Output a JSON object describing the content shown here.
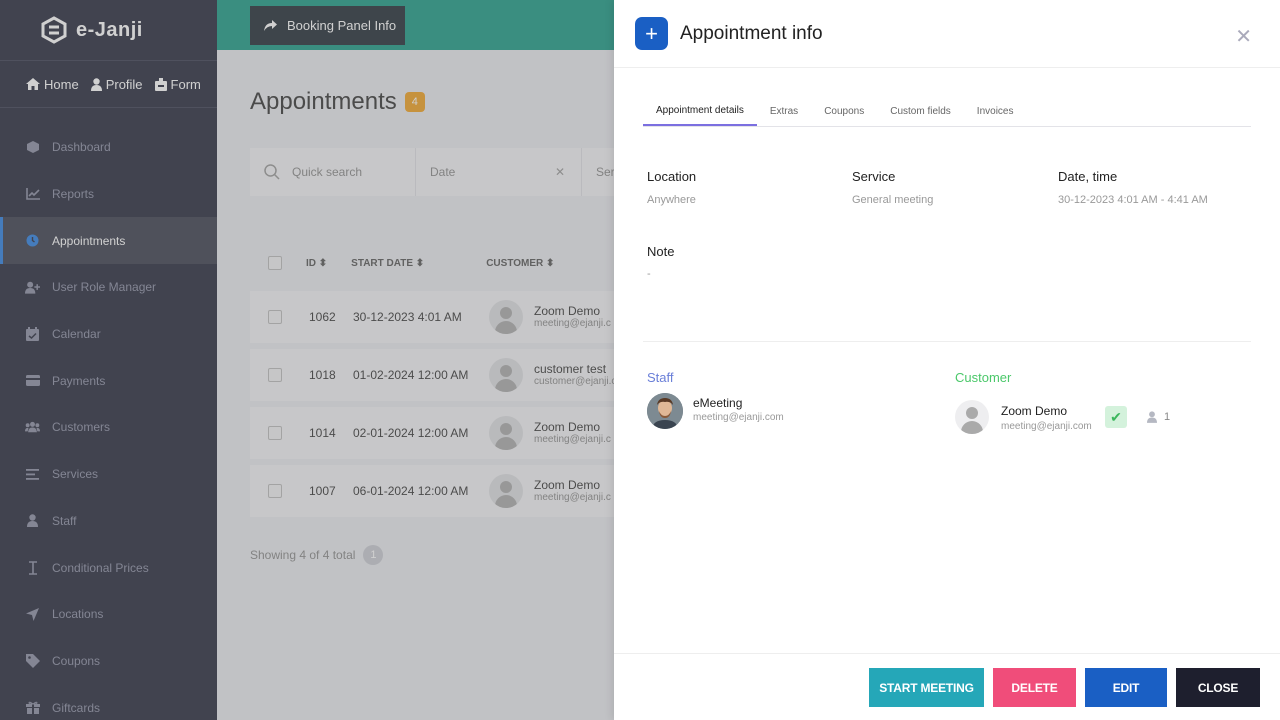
{
  "app": {
    "logo_text": "e-Janji"
  },
  "quicknav": [
    {
      "label": "Home"
    },
    {
      "label": "Profile"
    },
    {
      "label": "Form"
    }
  ],
  "sidebar": {
    "items": [
      {
        "label": "Dashboard",
        "icon": "cube-icon"
      },
      {
        "label": "Reports",
        "icon": "chart-icon"
      },
      {
        "label": "Appointments",
        "icon": "clock-icon",
        "active": true
      },
      {
        "label": "User Role Manager",
        "icon": "user-plus-icon"
      },
      {
        "label": "Calendar",
        "icon": "calendar-icon"
      },
      {
        "label": "Payments",
        "icon": "card-icon"
      },
      {
        "label": "Customers",
        "icon": "users-icon"
      },
      {
        "label": "Services",
        "icon": "list-icon"
      },
      {
        "label": "Staff",
        "icon": "user-icon"
      },
      {
        "label": "Conditional Prices",
        "icon": "text-cursor-icon"
      },
      {
        "label": "Locations",
        "icon": "location-arrow-icon"
      },
      {
        "label": "Coupons",
        "icon": "tag-icon"
      },
      {
        "label": "Giftcards",
        "icon": "gift-icon"
      }
    ]
  },
  "topbar": {
    "booking_panel_label": "Booking Panel Info"
  },
  "page": {
    "title": "Appointments",
    "count": "4"
  },
  "filters": {
    "search_placeholder": "Quick search",
    "date_placeholder": "Date",
    "service_placeholder": "Serv"
  },
  "table": {
    "columns": [
      "ID",
      "START DATE",
      "CUSTOMER"
    ],
    "rows": [
      {
        "id": "1062",
        "start": "30-12-2023 4:01 AM",
        "customer": "Zoom Demo",
        "email": "meeting@ejanji.c"
      },
      {
        "id": "1018",
        "start": "01-02-2024 12:00 AM",
        "customer": "customer test",
        "email": "customer@ejanji.c"
      },
      {
        "id": "1014",
        "start": "02-01-2024 12:00 AM",
        "customer": "Zoom Demo",
        "email": "meeting@ejanji.c"
      },
      {
        "id": "1007",
        "start": "06-01-2024 12:00 AM",
        "customer": "Zoom Demo",
        "email": "meeting@ejanji.c"
      }
    ],
    "showing": "Showing 4 of 4 total",
    "page": "1"
  },
  "panel": {
    "title": "Appointment info",
    "close_glyph": "✕",
    "tabs": [
      "Appointment details",
      "Extras",
      "Coupons",
      "Custom fields",
      "Invoices"
    ],
    "location_label": "Location",
    "location_value": "Anywhere",
    "service_label": "Service",
    "service_value": "General meeting",
    "datetime_label": "Date, time",
    "datetime_value": "30-12-2023 4:01 AM - 4:41 AM",
    "note_label": "Note",
    "note_value": "-",
    "staff_label": "Staff",
    "staff_name": "eMeeting",
    "staff_email": "meeting@ejanji.com",
    "customer_label": "Customer",
    "customer_name": "Zoom Demo",
    "customer_email": "meeting@ejanji.com",
    "persons": "1",
    "buttons": {
      "start": "START MEETING",
      "delete": "DELETE",
      "edit": "EDIT",
      "close": "CLOSE"
    }
  }
}
